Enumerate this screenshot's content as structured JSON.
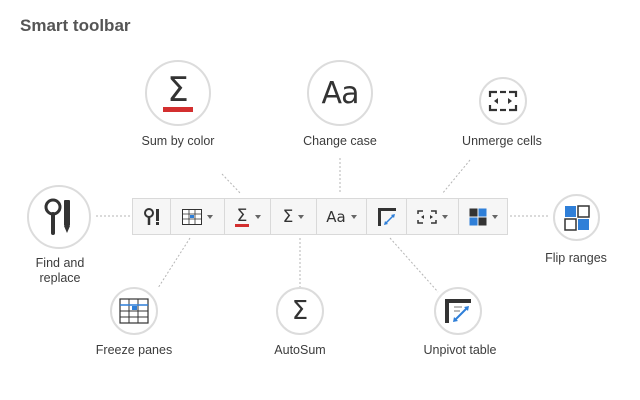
{
  "title": "Smart toolbar",
  "features": {
    "sum_by_color": "Sum by color",
    "change_case": "Change case",
    "unmerge_cells": "Unmerge cells",
    "find_and_replace_line1": "Find and",
    "find_and_replace_line2": "replace",
    "flip_ranges": "Flip ranges",
    "freeze_panes": "Freeze panes",
    "autosum": "AutoSum",
    "unpivot_table": "Unpivot table"
  },
  "glyphs": {
    "sigma": "Σ",
    "aa": "Aa"
  },
  "colors": {
    "accent_red": "#d32f2f",
    "accent_blue": "#2f7fd8",
    "circle_border": "#dcdcdc",
    "connector": "#b5b5b5"
  },
  "toolbar_buttons": [
    {
      "icon": "find-replace-icon"
    },
    {
      "icon": "freeze-panes-icon",
      "dropdown": true
    },
    {
      "icon": "sum-by-color-icon",
      "dropdown": true
    },
    {
      "icon": "autosum-icon",
      "dropdown": true
    },
    {
      "icon": "change-case-icon",
      "dropdown": true
    },
    {
      "icon": "unpivot-table-icon"
    },
    {
      "icon": "unmerge-cells-icon",
      "dropdown": true
    },
    {
      "icon": "flip-ranges-icon",
      "dropdown": true
    }
  ]
}
